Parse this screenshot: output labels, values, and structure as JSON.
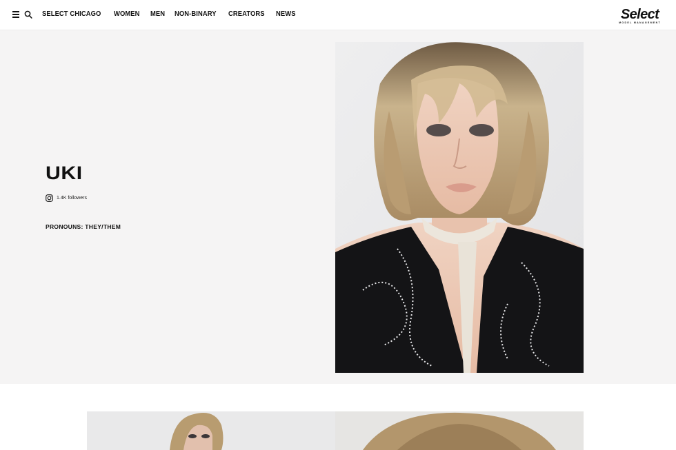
{
  "header": {
    "nav": [
      "SELECT CHICAGO",
      "WOMEN",
      "MEN",
      "NON-BINARY",
      "CREATORS",
      "NEWS"
    ],
    "logo": {
      "word": "Select",
      "sub": "MODEL MANAGEMENT"
    },
    "icons": {
      "menu": "hamburger-menu-icon",
      "search": "search-icon"
    }
  },
  "profile": {
    "name": "UKI",
    "instagram_followers": "1.4K followers",
    "pronouns": "PRONOUNS: THEY/THEM"
  },
  "colors": {
    "hero_bg": "#f5f4f4",
    "page_bg": "#ffffff",
    "text": "#111111"
  }
}
